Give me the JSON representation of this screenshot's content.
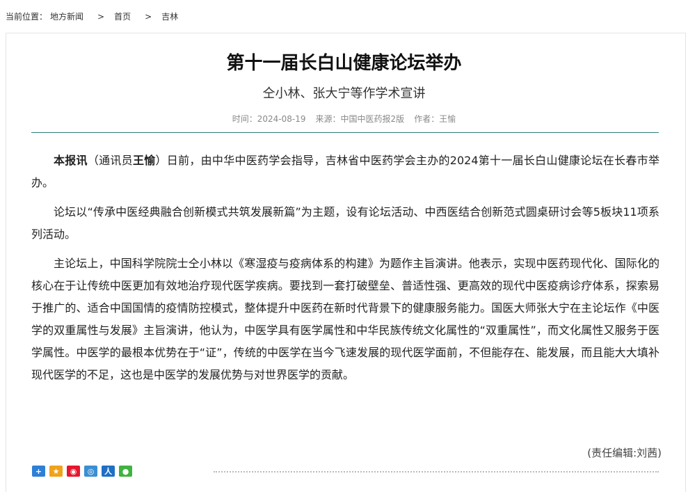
{
  "breadcrumb": {
    "prefix": "当前位置：",
    "items": [
      "地方新闻",
      "首页",
      "吉林"
    ],
    "separator": ">"
  },
  "article": {
    "title": "第十一届长白山健康论坛举办",
    "subtitle": "仝小林、张大宁等作学术宣讲",
    "meta": {
      "time_label": "时间：",
      "time": "2024-08-19",
      "source_label": "来源：",
      "source": "中国中医药报2版",
      "author_label": "作者：",
      "author": "王愉"
    },
    "p1": {
      "lead": "本报讯",
      "open": "（通讯员",
      "reporter": "王愉",
      "rest": "）日前，由中华中医药学会指导，吉林省中医药学会主办的2024第十一届长白山健康论坛在长春市举办。"
    },
    "p2": "论坛以“传承中医经典融合创新模式共筑发展新篇”为主题，设有论坛活动、中西医结合创新范式圆桌研讨会等5板块11项系列活动。",
    "p3": "主论坛上，中国科学院院士仝小林以《寒湿疫与疫病体系的构建》为题作主旨演讲。他表示，实现中医药现代化、国际化的核心在于让传统中医更加有效地治疗现代医学疾病。要找到一套打破壁垒、普适性强、更高效的现代中医疫病诊疗体系，探索易于推广的、适合中国国情的疫情防控模式，整体提升中医药在新时代背景下的健康服务能力。国医大师张大宁在主论坛作《中医学的双重属性与发展》主旨演讲，他认为，中医学具有医学属性和中华民族传统文化属性的“双重属性”，而文化属性又服务于医学属性。中医学的最根本优势在于“证”，传统的中医学在当今飞速发展的现代医学面前，不但能存在、能发展，而且能大大填补现代医学的不足，这也是中医学的发展优势与对世界医学的贡献。",
    "editor": "(责任编辑:刘茜)"
  },
  "share": {
    "icons": [
      {
        "name": "share-more-icon",
        "glyph": "+",
        "color": "#2e7fd6"
      },
      {
        "name": "share-qzone-icon",
        "glyph": "★",
        "color": "#f0a21b"
      },
      {
        "name": "share-weibo-icon",
        "glyph": "◉",
        "color": "#e6162d"
      },
      {
        "name": "share-tencent-weibo-icon",
        "glyph": "◎",
        "color": "#3b8fd1"
      },
      {
        "name": "share-renren-icon",
        "glyph": "人",
        "color": "#1f6fc5"
      },
      {
        "name": "share-wechat-icon",
        "glyph": "●",
        "color": "#3fb33f"
      }
    ]
  }
}
